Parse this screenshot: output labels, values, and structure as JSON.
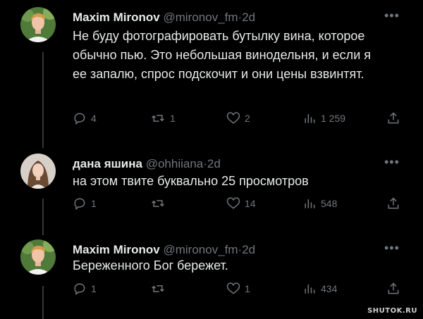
{
  "tweets": [
    {
      "name": "Maxim Mironov",
      "handle": "@mironov_fm",
      "separator": "·",
      "time": "2d",
      "text": "Не буду фотографировать бутылку вина, которое обычно пью. Это небольшая винодельня, и если я ее запалю, спрос подскочит и они цены взвинтят.",
      "replies": "4",
      "retweets": "1",
      "likes": "2",
      "views": "1 259"
    },
    {
      "name": "дана яшина",
      "handle": "@ohhiiana",
      "separator": "·",
      "time": "2d",
      "text": "на этом твите буквально 25 просмотров",
      "replies": "1",
      "retweets": "",
      "likes": "14",
      "views": "548"
    },
    {
      "name": "Maxim Mironov",
      "handle": "@mironov_fm",
      "separator": "·",
      "time": "2d",
      "text": "Береженного Бог бережет.",
      "replies": "1",
      "retweets": "",
      "likes": "1",
      "views": "434"
    }
  ],
  "icons": {
    "more": "more-icon",
    "reply": "reply-icon",
    "retweet": "retweet-icon",
    "like": "like-icon",
    "views": "views-icon",
    "share": "share-icon"
  },
  "colors": {
    "background": "#000000",
    "text": "#e7e9ea",
    "muted": "#71767b",
    "thread_line": "#333639"
  },
  "watermark": "SHUTOK.RU"
}
